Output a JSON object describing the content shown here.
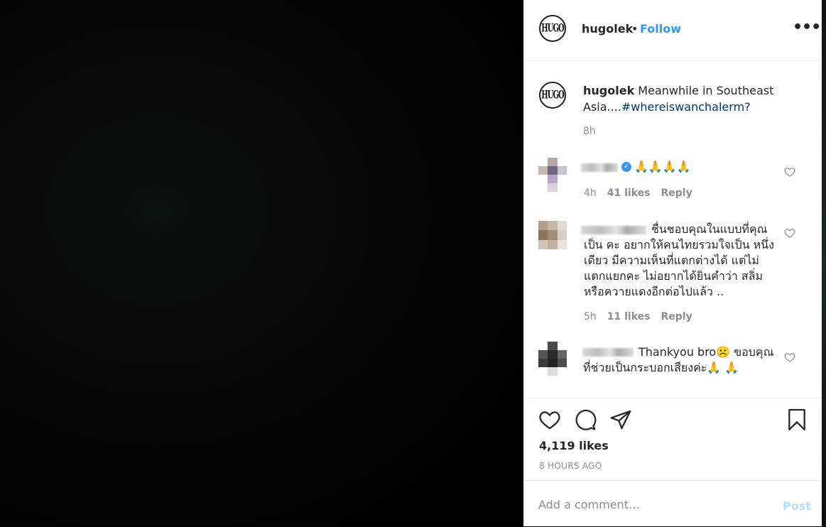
{
  "post": {
    "username": "hugolek",
    "logo_text": "HUGO",
    "separator": "•",
    "follow_label": "Follow",
    "more_label": "•••"
  },
  "caption": {
    "username": "hugolek",
    "text": "Meanwhile in Southeast Asia....",
    "hashtag": "#whereiswanchalerm?",
    "time": "8h"
  },
  "comments": [
    {
      "text": "🙏🙏🙏🙏",
      "time": "4h",
      "likes": "41 likes",
      "reply": "Reply",
      "verified": true
    },
    {
      "text": "ชื่นชอบคุณในแบบที่คุณ เป็น คะ อยากให้คนไทยรวมใจเป็น หนึ่งเดียว มีความเห็นที่แตกต่างได้ แต่ไม่แตกแยกคะ ไม่อยากได้ยินคำว่า สลิ่มหรือควายแดงอีกต่อไปแล้ว ..",
      "time": "5h",
      "likes": "11 likes",
      "reply": "Reply"
    },
    {
      "text": "Thankyou bro☹️ ขอบคุณที่ช่วยเป็นกระบอกเสียงค่ะ🙏 🙏"
    }
  ],
  "likes": "4,119 likes",
  "posted_ago": "8 HOURS AGO",
  "add_comment": {
    "placeholder": "Add a comment…",
    "post_label": "Post"
  },
  "colors": {
    "accent": "#3897f0",
    "hashtag": "#00376b",
    "muted": "#8e8e8e",
    "post_disabled": "#b2dffc"
  }
}
